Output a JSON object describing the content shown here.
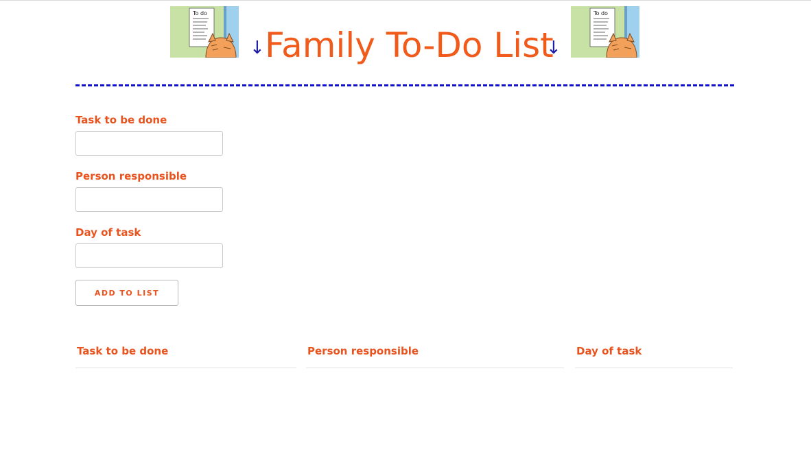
{
  "header": {
    "title": "Family To-Do List",
    "arrow_glyph": "↓",
    "thumbnail_text": "To do"
  },
  "form": {
    "task_label": "Task to be done",
    "task_value": "",
    "person_label": "Person responsible",
    "person_value": "",
    "day_label": "Day of task",
    "day_value": "",
    "add_button_label": "ADD TO LIST"
  },
  "table": {
    "columns": [
      "Task to be done",
      "Person responsible",
      "Day of task"
    ],
    "rows": []
  },
  "colors": {
    "title": "#f05a1a",
    "label": "#e8531e",
    "arrow": "#1a1aa6",
    "divider": "#1111cc",
    "thumbnail_bg": "#c8e2a6",
    "thumbnail_sky": "#9fd0ee",
    "cat": "#f2a05a"
  }
}
